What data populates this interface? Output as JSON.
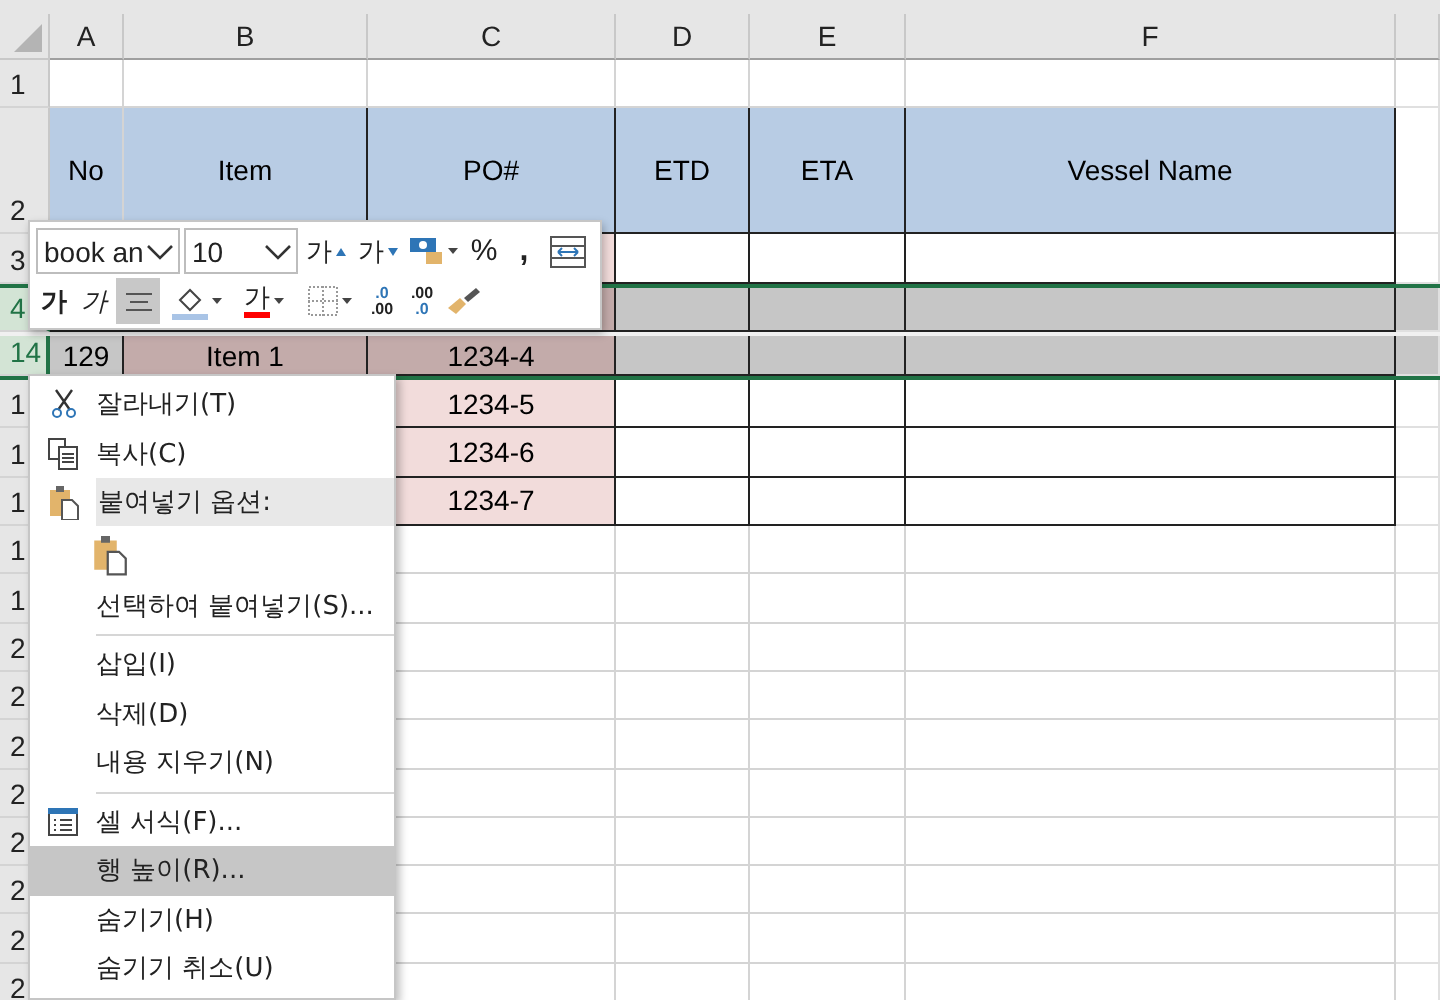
{
  "sheet": {
    "columns": [
      "A",
      "B",
      "C",
      "D",
      "E",
      "F"
    ],
    "rows": [
      {
        "label": "1",
        "kind": "blank",
        "selected": false
      },
      {
        "label": "2",
        "kind": "header",
        "selected": false,
        "cells": {
          "A": "No",
          "B": "Item",
          "C": "PO#",
          "D": "ETD",
          "E": "ETA",
          "F": "Vessel Name"
        }
      },
      {
        "label": "3",
        "kind": "data",
        "selected": false
      },
      {
        "label": "4",
        "kind": "data",
        "selected": true
      },
      {
        "label": "14",
        "kind": "data",
        "selected": true,
        "cells": {
          "A": "129",
          "B": "Item 1",
          "C": "1234-4"
        }
      },
      {
        "label": "1",
        "kind": "data",
        "selected": false,
        "cells": {
          "C": "1234-5"
        }
      },
      {
        "label": "1",
        "kind": "data",
        "selected": false,
        "cells": {
          "C": "1234-6"
        }
      },
      {
        "label": "1",
        "kind": "data",
        "selected": false,
        "cells": {
          "C": "1234-7"
        }
      },
      {
        "label": "1",
        "kind": "blank",
        "selected": false
      },
      {
        "label": "1",
        "kind": "blank",
        "selected": false
      },
      {
        "label": "2",
        "kind": "blank",
        "selected": false
      },
      {
        "label": "2",
        "kind": "blank",
        "selected": false
      },
      {
        "label": "2",
        "kind": "blank",
        "selected": false
      },
      {
        "label": "2",
        "kind": "blank",
        "selected": false
      },
      {
        "label": "2",
        "kind": "blank",
        "selected": false
      },
      {
        "label": "2",
        "kind": "blank",
        "selected": false
      },
      {
        "label": "2",
        "kind": "blank",
        "selected": false
      },
      {
        "label": "2",
        "kind": "blank",
        "selected": false
      }
    ]
  },
  "mini_toolbar": {
    "font": "book an",
    "size": "10",
    "grow_font": "가",
    "shrink_font": "가",
    "percent": "%",
    "comma": ",",
    "bold": "가",
    "italic": "가",
    "center_align": {
      "selected": true
    },
    "font_color": "가",
    "increase_decimal": [
      ".0",
      ".00"
    ],
    "decrease_decimal": [
      ".00",
      ".0"
    ]
  },
  "context_menu": [
    {
      "kind": "command",
      "label": "잘라내기(T)",
      "selected": false
    },
    {
      "kind": "command",
      "label": "복사(C)",
      "selected": false
    },
    {
      "kind": "group-header",
      "label": "붙여넣기 옵션:"
    },
    {
      "kind": "paste-option"
    },
    {
      "kind": "command",
      "label": "선택하여 붙여넣기(S)...",
      "selected": false
    },
    {
      "kind": "separator"
    },
    {
      "kind": "command",
      "label": "삽입(I)",
      "selected": false
    },
    {
      "kind": "command",
      "label": "삭제(D)",
      "selected": false
    },
    {
      "kind": "command",
      "label": "내용 지우기(N)",
      "selected": false
    },
    {
      "kind": "separator"
    },
    {
      "kind": "command",
      "label": "셀 서식(F)...",
      "selected": false
    },
    {
      "kind": "command",
      "label": "행 높이(R)...",
      "selected": true
    },
    {
      "kind": "command",
      "label": "숨기기(H)",
      "selected": false
    },
    {
      "kind": "command",
      "label": "숨기기 취소(U)",
      "selected": false
    }
  ]
}
